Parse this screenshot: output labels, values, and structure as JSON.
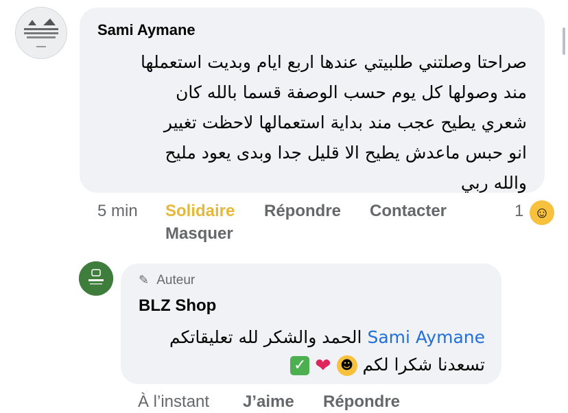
{
  "comment": {
    "author": "Sami Aymane",
    "text_lines": [
      "صراحتا وصلتني طلبيتي عندها اربع ايام وبديت استعملها",
      "مند وصولها كل يوم حسب الوصفة قسما بالله كان",
      "شعري يطيح عجب مند بداية استعمالها لاحظت تغيير",
      "انو حبس ماعدش يطيح الا قليل جدا وبدى يعود مليح",
      "والله ربي"
    ],
    "actions": {
      "time": "5 min",
      "solidaire": "Solidaire",
      "reply": "Répondre",
      "contact": "Contacter",
      "hide": "Masquer"
    },
    "reaction_count": "1",
    "reaction_icon": "care-emoji-icon"
  },
  "reply": {
    "badge": "Auteur",
    "author": "BLZ Shop",
    "mention": "Sami Aymane",
    "line1_text": "الحمد والشكر لله تعليقاتكم",
    "line2_text": "تسعدنا شكرا لكم",
    "emojis": [
      "hugging-face-icon",
      "red-heart-icon",
      "check-mark-icon"
    ],
    "actions": {
      "time": "À l’instant",
      "like": "J’aime",
      "reply": "Répondre"
    }
  },
  "colors": {
    "bubble": "#f0f2f5",
    "solidaire": "#e5b83a",
    "mention": "#216fdb",
    "muted": "#65676b",
    "avatar_brand": "#3f7d3d"
  }
}
